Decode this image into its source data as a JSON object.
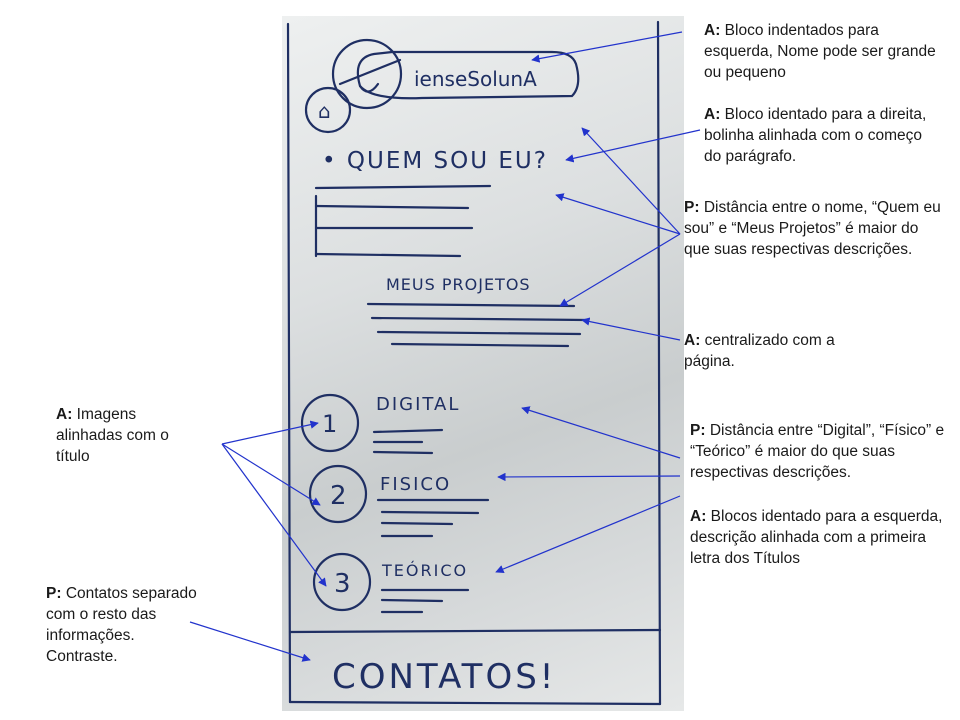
{
  "sketch": {
    "logo_text": "ienseSolunA",
    "section_about": "• QUEM SOU EU?",
    "section_projects": "MEUS PROJETOS",
    "item_1_number": "1",
    "item_1_title": "DIGITAL",
    "item_2_number": "2",
    "item_2_title": "FISICO",
    "item_3_number": "3",
    "item_3_title": "TEÓRICO",
    "footer": "CONTATOS!",
    "home_icon": "home-icon"
  },
  "annotations": {
    "a1": {
      "tag": "A:",
      "text": "Bloco indentados  para esquerda, Nome pode ser grande ou pequeno"
    },
    "a2": {
      "tag": "A:",
      "text": "Bloco identado para a direita, bolinha alinhada com o começo do parágrafo."
    },
    "p1": {
      "tag": "P:",
      "text": "Distância entre o nome, “Quem eu sou” e “Meus Projetos” é maior do que suas respectivas descrições."
    },
    "a3": {
      "tag": "A:",
      "text": "centralizado com a página."
    },
    "p2": {
      "tag": "P:",
      "text": "Distância entre “Digital”, “Físico” e “Teórico” é maior do que suas respectivas descrições."
    },
    "a4": {
      "tag": "A:",
      "text": "Blocos identado para a esquerda, descrição alinhada com a primeira letra dos Títulos"
    },
    "a5": {
      "tag": "A:",
      "text": "Imagens alinhadas com o título"
    },
    "p3": {
      "tag": "P:",
      "text": "Contatos separado com o resto das informações. Contraste."
    }
  },
  "colors": {
    "ink": "#1f2f63",
    "arrow": "#2233cc",
    "background": "#ffffff"
  }
}
